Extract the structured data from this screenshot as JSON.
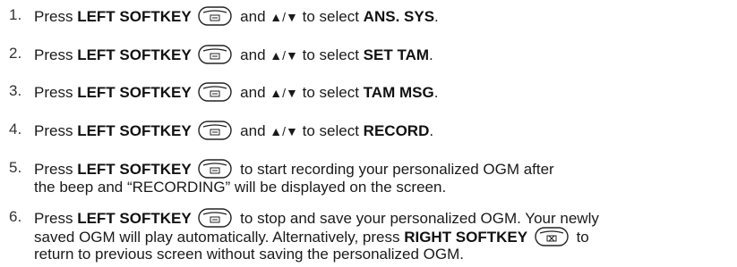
{
  "steps": [
    {
      "number": "1.",
      "press": "Press",
      "key": "LEFT SOFTKEY",
      "and": "and",
      "arrows": "▲/▼",
      "to_select": "to select",
      "target": "ANS. SYS",
      "end": "."
    },
    {
      "number": "2.",
      "press": "Press",
      "key": "LEFT SOFTKEY",
      "and": "and",
      "arrows": "▲/▼",
      "to_select": "to select",
      "target": "SET TAM",
      "end": "."
    },
    {
      "number": "3.",
      "press": "Press",
      "key": "LEFT SOFTKEY",
      "and": "and",
      "arrows": "▲/▼",
      "to_select": "to select",
      "target": "TAM MSG",
      "end": "."
    },
    {
      "number": "4.",
      "press": "Press",
      "key": "LEFT SOFTKEY",
      "and": "and",
      "arrows": "▲/▼",
      "to_select": "to select",
      "target": "RECORD",
      "end": "."
    },
    {
      "number": "5.",
      "press": "Press",
      "key": "LEFT SOFTKEY",
      "text_a": "to start recording your personalized OGM after",
      "text_b": "the beep and “RECORDING” will be displayed on the screen."
    },
    {
      "number": "6.",
      "press": "Press",
      "key": "LEFT SOFTKEY",
      "text_a": "to stop and save your personalized OGM. Your newly",
      "text_b_pre": "saved OGM will play automatically. Alternatively, press",
      "key2": "RIGHT SOFTKEY",
      "text_b_post": "to",
      "text_c": "return to previous screen without saving the personalized OGM."
    }
  ],
  "icons": {
    "left_softkey": "left-softkey-icon",
    "right_softkey": "right-softkey-icon",
    "up_down_arrows": "up-down-arrows-icon"
  }
}
